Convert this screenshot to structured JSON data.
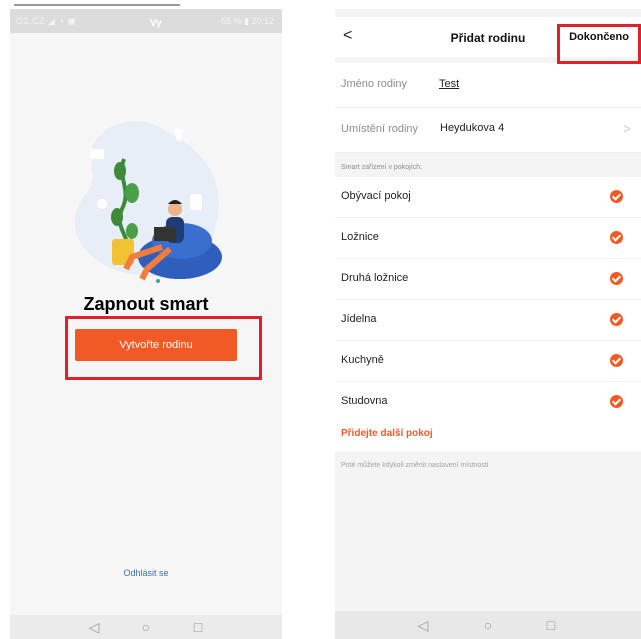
{
  "left_screen": {
    "status": {
      "carrier": "O2.CZ",
      "center": "Vy",
      "battery": "68 %",
      "time": "20:12"
    },
    "headline": "Zapnout smart",
    "create_button": "Vytvořte rodinu",
    "logout_link": "Odhlásit se",
    "nav": [
      "back-triangle",
      "home-circle",
      "recent-square"
    ]
  },
  "right_screen": {
    "header": {
      "back": "<",
      "title": "Přidat rodinu",
      "done": "Dokončeno"
    },
    "form": {
      "name_label": "Jméno rodiny",
      "name_value": "Test",
      "location_label": "Umístění rodiny",
      "location_value": "Heydukova 4",
      "chevron": ">"
    },
    "rooms_section_title": "Smart zařízení v pokojích:",
    "rooms": [
      {
        "name": "Obývací pokoj",
        "checked": true
      },
      {
        "name": "Ložnice",
        "checked": true
      },
      {
        "name": "Druhá ložnice",
        "checked": true
      },
      {
        "name": "Jídelna",
        "checked": true
      },
      {
        "name": "Kuchyně",
        "checked": true
      },
      {
        "name": "Studovna",
        "checked": true
      }
    ],
    "add_room": "Přidejte další pokoj",
    "note": "Poté můžete kdykoli změnit nastavení místnosti"
  },
  "colors": {
    "accent": "#f15a24",
    "highlight": "#e0202a",
    "link": "#3d6fb4"
  }
}
